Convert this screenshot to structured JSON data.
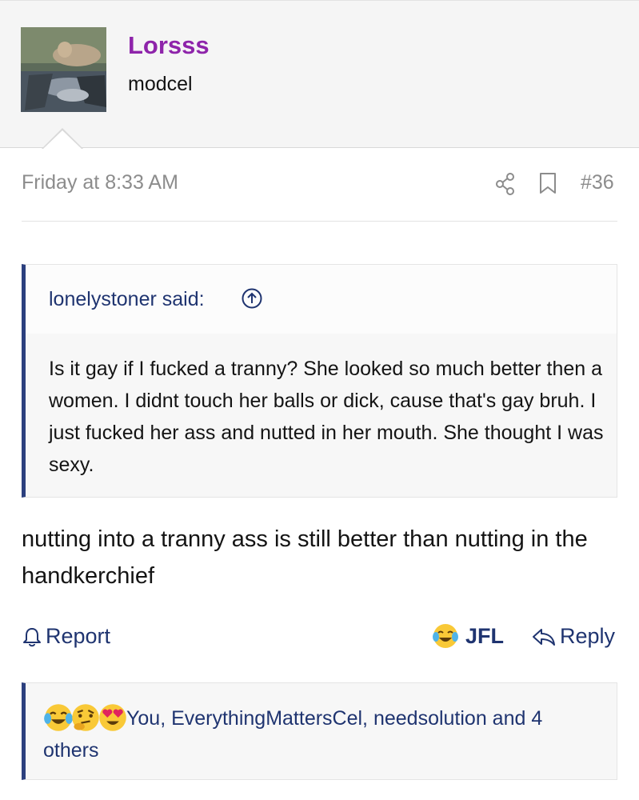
{
  "user": {
    "name": "Lorsss",
    "title": "modcel",
    "name_color": "#8e24aa"
  },
  "post": {
    "date": "Friday at 8:33 AM",
    "number": "#36",
    "message": "nutting into a tranny ass is still better than nutting in the handkerchief"
  },
  "quote": {
    "author": "lonelystoner said:",
    "body": "Is it gay if I fucked a tranny? She looked so much better then a women. I didnt touch her balls or dick, cause that's gay bruh. I just fucked her ass and nutted in her mouth. She thought I was sexy."
  },
  "actions": {
    "report": "Report",
    "reaction": "JFL",
    "reply": "Reply"
  },
  "reactions": {
    "icons": [
      "joy-emoji-icon",
      "thinking-emoji-icon",
      "heart-eyes-emoji-icon"
    ],
    "text": "You, EverythingMattersCel, needsolution and 4 others"
  },
  "colors": {
    "accent": "#1f3470",
    "quote_border": "#2b3f7e",
    "muted": "#8c8c8c"
  }
}
